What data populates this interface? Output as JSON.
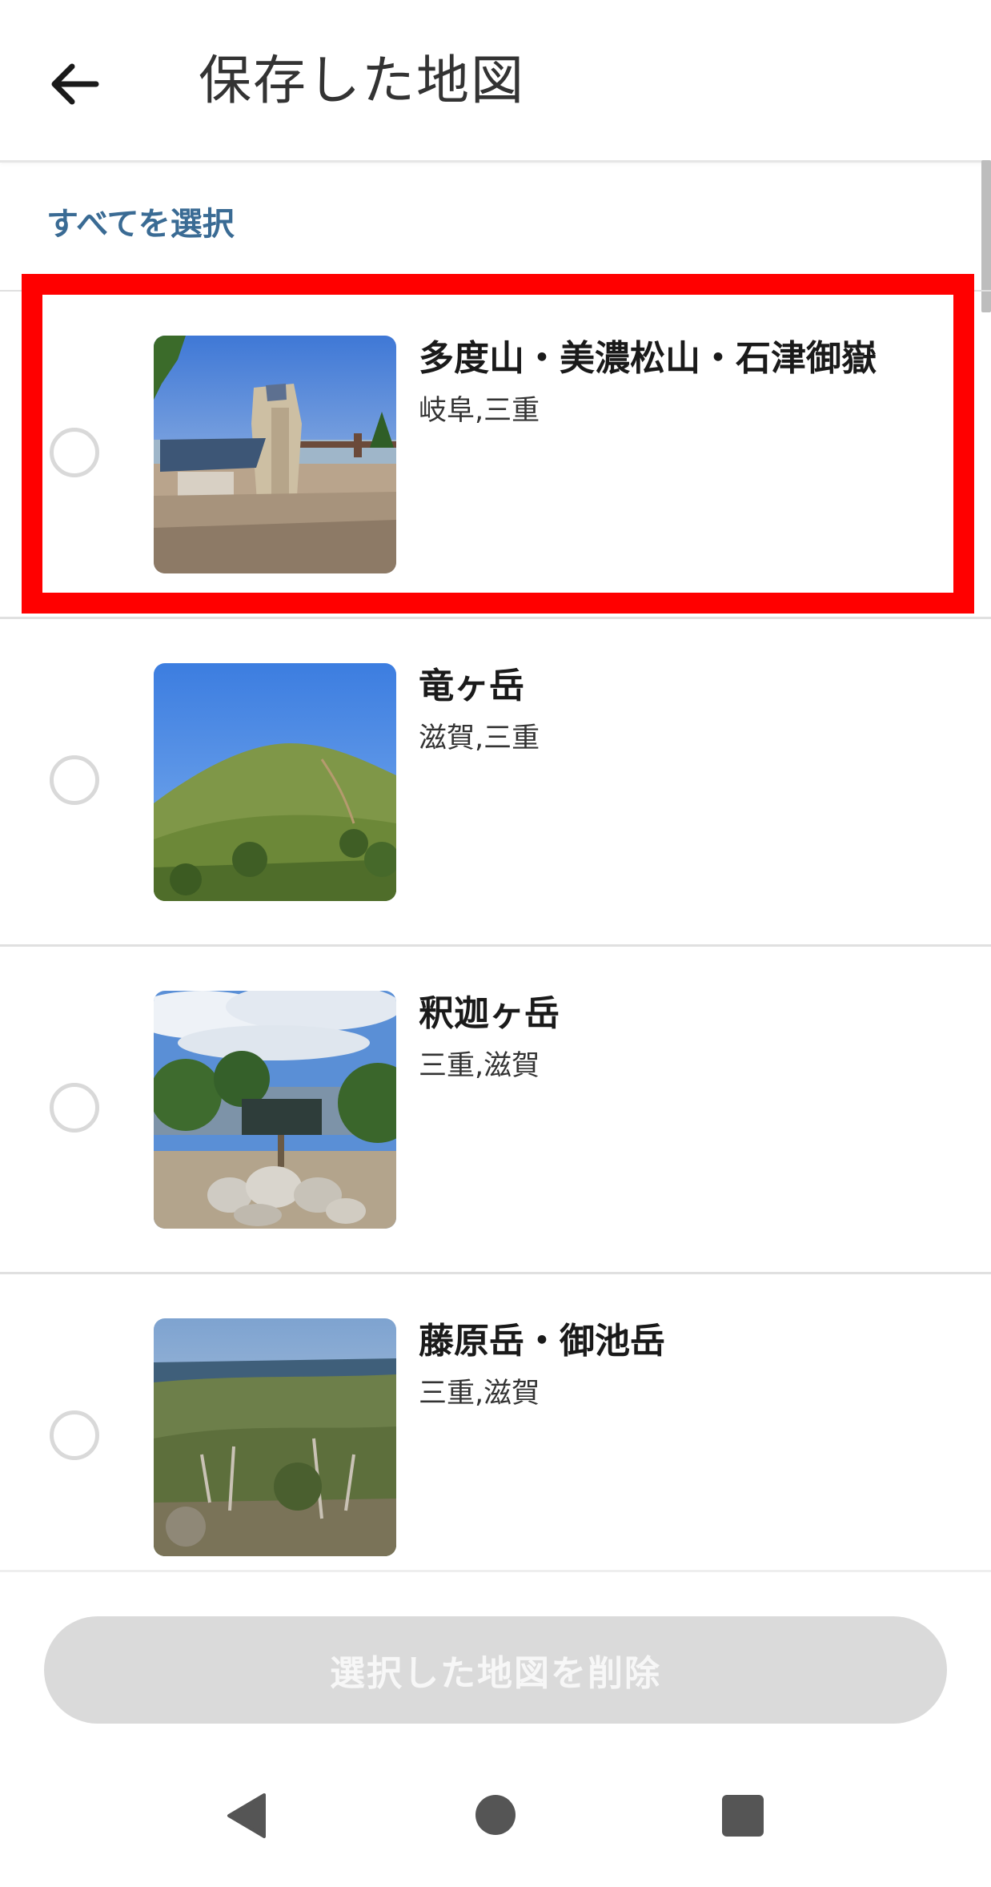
{
  "header": {
    "title": "保存した地図",
    "back_icon": "arrow-left-icon"
  },
  "select_all": {
    "label": "すべてを選択"
  },
  "maps": [
    {
      "name": "多度山・美濃松山・石津御嶽",
      "region": "岐阜,三重",
      "selected": false,
      "highlighted": true
    },
    {
      "name": "竜ヶ岳",
      "region": "滋賀,三重",
      "selected": false,
      "highlighted": false
    },
    {
      "name": "釈迦ヶ岳",
      "region": "三重,滋賀",
      "selected": false,
      "highlighted": false
    },
    {
      "name": "藤原岳・御池岳",
      "region": "三重,滋賀",
      "selected": false,
      "highlighted": false
    }
  ],
  "footer": {
    "delete_label": "選択した地図を削除",
    "delete_enabled": false
  },
  "colors": {
    "accent": "#3a6b94",
    "highlight": "#ff0000",
    "button_disabled": "#dadada"
  }
}
